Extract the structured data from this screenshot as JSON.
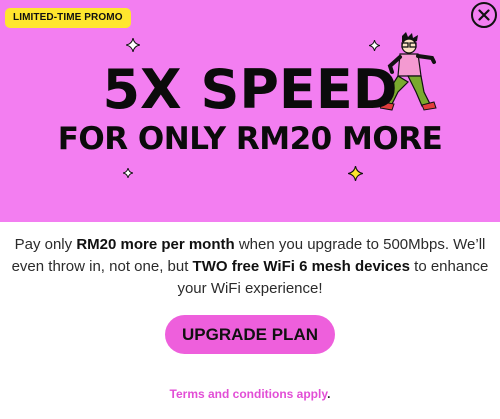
{
  "promo": {
    "badge": "LIMITED-TIME PROMO",
    "headline": "5X SPEED",
    "subheadline": "FOR ONLY RM20 MORE",
    "body": {
      "part1": "Pay only ",
      "bold1": "RM20 more per month",
      "part2": " when you upgrade to 500Mbps. We’ll even throw in, not one, but ",
      "bold2": "TWO free WiFi 6 mesh devices",
      "part3": " to enhance your WiFi experience!"
    },
    "cta_label": "UPGRADE PLAN",
    "terms_link": "Terms and conditions apply",
    "terms_period": "."
  },
  "icons": {
    "close": "close-icon",
    "sparkle": "sparkle-icon",
    "illustration": "running-man-illustration"
  },
  "colors": {
    "banner_bg": "#f37ef1",
    "badge_bg": "#ffe62e",
    "button_bg": "#ee5fdc",
    "link": "#e24ed6"
  }
}
